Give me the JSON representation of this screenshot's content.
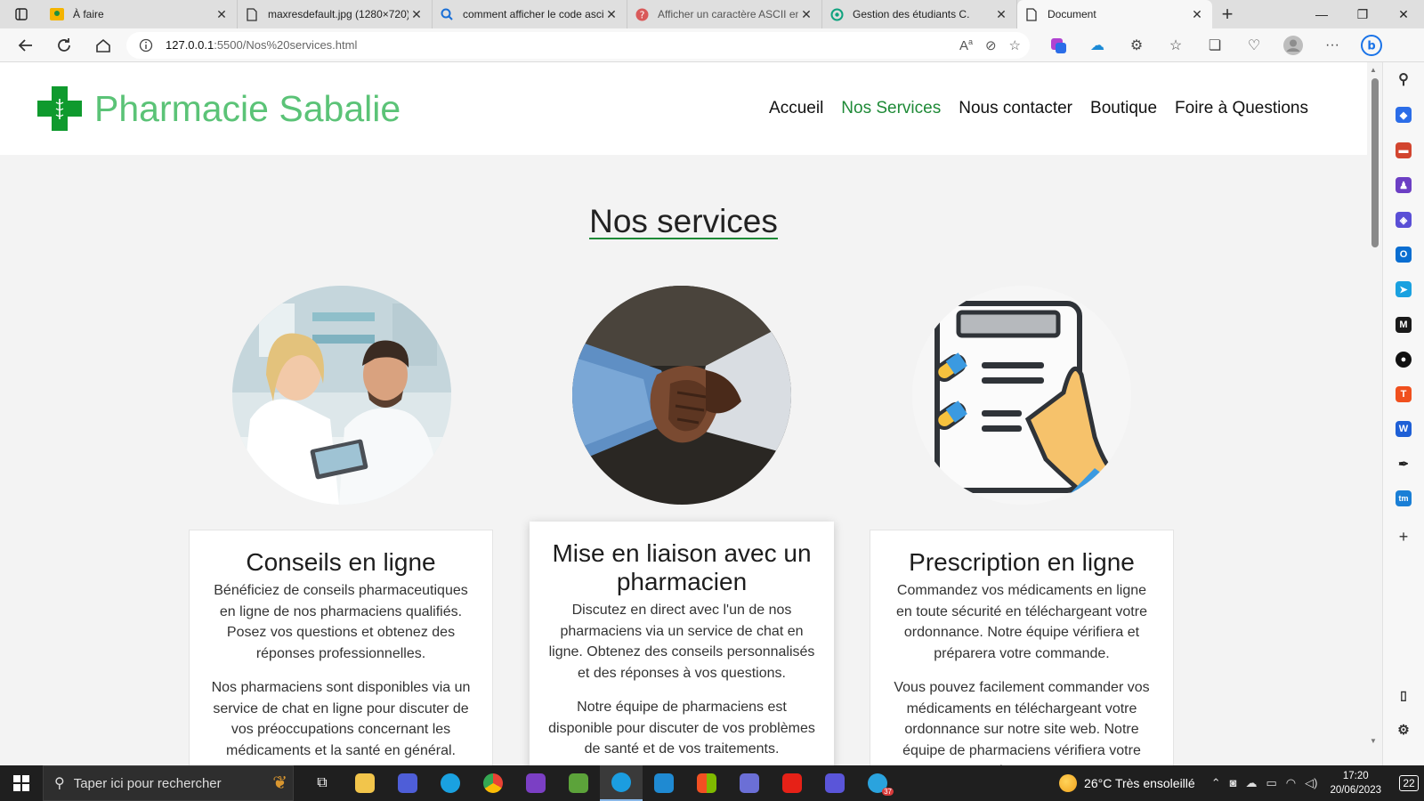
{
  "browser": {
    "tabs": [
      {
        "title": "À faire",
        "active": false
      },
      {
        "title": "maxresdefault.jpg (1280×720)",
        "active": false
      },
      {
        "title": "comment afficher le code ascii",
        "active": false
      },
      {
        "title": "Afficher un caractère ASCII en",
        "active": false
      },
      {
        "title": "Gestion des étudiants C.",
        "active": false
      },
      {
        "title": "Document",
        "active": true
      }
    ],
    "url_host": "127.0.0.1",
    "url_path": ":5500/Nos%20services.html"
  },
  "site": {
    "brand": "Pharmacie Sabalie",
    "nav": [
      {
        "label": "Accueil",
        "current": false
      },
      {
        "label": "Nos Services",
        "current": true
      },
      {
        "label": "Nous contacter",
        "current": false
      },
      {
        "label": "Boutique",
        "current": false
      },
      {
        "label": "Foire à Questions",
        "current": false
      }
    ],
    "section_title": "Nos services",
    "services": [
      {
        "title": "Conseils en ligne",
        "paragraphs": [
          "Bénéficiez de conseils pharmaceutiques en ligne de nos pharmaciens qualifiés. Posez vos questions et obtenez des réponses professionnelles.",
          "Nos pharmaciens sont disponibles via un service de chat en ligne pour discuter de vos préoccupations concernant les médicaments et la santé en général."
        ]
      },
      {
        "title": "Mise en liaison avec un pharmacien",
        "paragraphs": [
          "Discutez en direct avec l'un de nos pharmaciens via un service de chat en ligne. Obtenez des conseils personnalisés et des réponses à vos questions.",
          "Notre équipe de pharmaciens est disponible pour discuter de vos problèmes de santé et de vos traitements."
        ]
      },
      {
        "title": "Prescription en ligne",
        "paragraphs": [
          "Commandez vos médicaments en ligne en toute sécurité en téléchargeant votre ordonnance. Notre équipe vérifiera et préparera votre commande.",
          "Vous pouvez facilement commander vos médicaments en téléchargeant votre ordonnance sur notre site web. Notre équipe de pharmaciens vérifiera votre ordonnance."
        ]
      }
    ]
  },
  "taskbar": {
    "search_placeholder": "Taper ici pour rechercher",
    "weather": "26°C  Très ensoleillé",
    "time": "17:20",
    "date": "20/06/2023",
    "notifications": "22",
    "telegram_badge": "37"
  },
  "colors": {
    "brand_green": "#0f9a2e",
    "brand_text": "#5bc377",
    "nav_active": "#1e8a37"
  }
}
